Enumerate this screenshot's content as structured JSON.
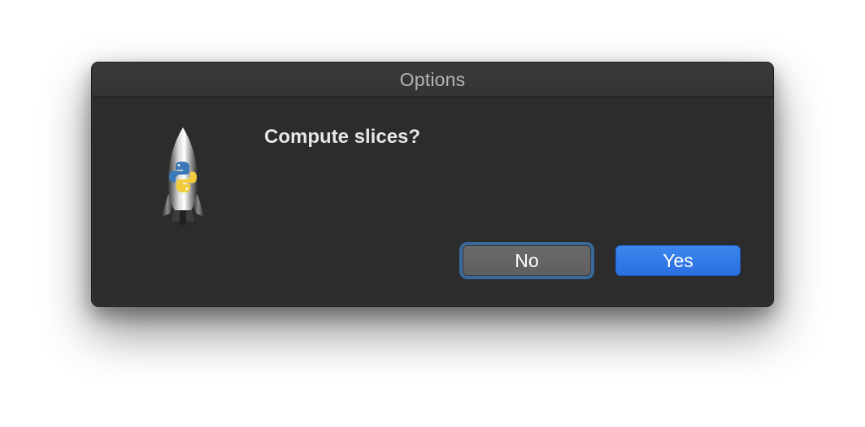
{
  "window": {
    "title": "Options"
  },
  "dialog": {
    "message": "Compute slices?",
    "icon": "python-rocket-icon"
  },
  "buttons": {
    "no_label": "No",
    "yes_label": "Yes"
  },
  "colors": {
    "dialog_background": "#2c2c2c",
    "titlebar": "#363636",
    "focus_ring": "#3a6a9c",
    "primary_button": "#2f76e6",
    "secondary_button": "#646464"
  }
}
